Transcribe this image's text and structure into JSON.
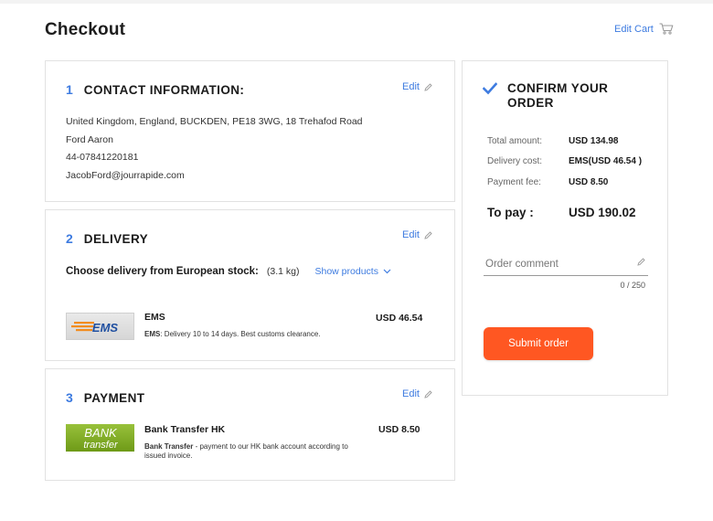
{
  "page": {
    "title": "Checkout",
    "edit_cart_label": "Edit Cart"
  },
  "contact": {
    "number": "1",
    "title": "CONTACT INFORMATION:",
    "edit_label": "Edit",
    "lines": [
      "United Kingdom, England, BUCKDEN, PE18 3WG, 18 Trehafod Road",
      "Ford Aaron",
      "44-07841220181",
      "JacobFord@jourrapide.com"
    ]
  },
  "delivery": {
    "number": "2",
    "title": "DELIVERY",
    "edit_label": "Edit",
    "choose_label": "Choose delivery from European stock:",
    "weight": "(3.1 kg)",
    "show_products_label": "Show products",
    "option": {
      "logo_text": "EMS",
      "name": "EMS",
      "desc_bold": "EMS",
      "desc_text": ": Delivery 10 to 14 days. Best customs clearance.",
      "price": "USD 46.54"
    }
  },
  "payment": {
    "number": "3",
    "title": "PAYMENT",
    "edit_label": "Edit",
    "option": {
      "logo_line1": "BANK",
      "logo_line2": "transfer",
      "name": "Bank Transfer HK",
      "desc_bold": "Bank Transfer",
      "desc_text": " - payment to our HK bank account according to issued invoice.",
      "price": "USD 8.50"
    }
  },
  "confirm": {
    "title": "CONFIRM YOUR ORDER",
    "rows": [
      {
        "label": "Total amount:",
        "value": "USD 134.98"
      },
      {
        "label": "Delivery cost:",
        "value": "EMS(USD 46.54 )"
      },
      {
        "label": "Payment fee:",
        "value": "USD 8.50"
      }
    ],
    "to_pay_label": "To pay :",
    "to_pay_value": "USD 190.02",
    "comment_placeholder": "Order comment",
    "comment_counter": "0 / 250",
    "submit_label": "Submit order"
  },
  "colors": {
    "accent": "#3d7be0",
    "submit": "#ff5722",
    "border": "#e2e2e2",
    "bank_green": "#8cb52e",
    "ems_orange": "#f28c1e",
    "ems_blue": "#1f4fa0"
  }
}
